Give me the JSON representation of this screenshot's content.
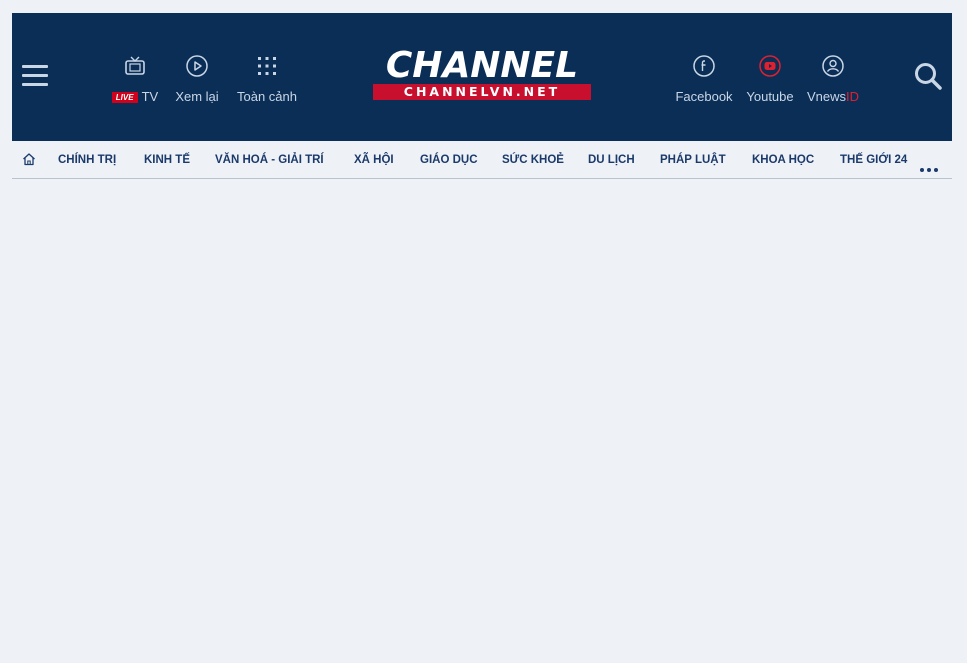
{
  "header": {
    "left_items": [
      {
        "label": "TV",
        "badge": "LIVE",
        "icon": "tv-icon"
      },
      {
        "label": "Xem lại",
        "icon": "play-circle-icon"
      },
      {
        "label": "Toàn cảnh",
        "icon": "grid-dots-icon"
      }
    ],
    "logo": {
      "main": "CHANNEL",
      "sub": "CHANNELVN.NET"
    },
    "right_items": [
      {
        "label": "Facebook",
        "icon": "facebook-icon"
      },
      {
        "label": "Youtube",
        "icon": "youtube-icon"
      },
      {
        "label_main": "Vnews",
        "label_accent": "ID",
        "icon": "user-icon"
      }
    ]
  },
  "nav": {
    "items": [
      "CHÍNH TRỊ",
      "KINH TẾ",
      "VĂN HOÁ - GIẢI TRÍ",
      "XÃ HỘI",
      "GIÁO DỤC",
      "SỨC KHOẺ",
      "DU LỊCH",
      "PHÁP LUẬT",
      "KHOA HỌC",
      "THẾ GIỚI 24"
    ]
  },
  "colors": {
    "header_bg": "#0b2e57",
    "accent_red": "#c8102e",
    "nav_text": "#1b3a6b",
    "page_bg": "#eef2f6"
  }
}
